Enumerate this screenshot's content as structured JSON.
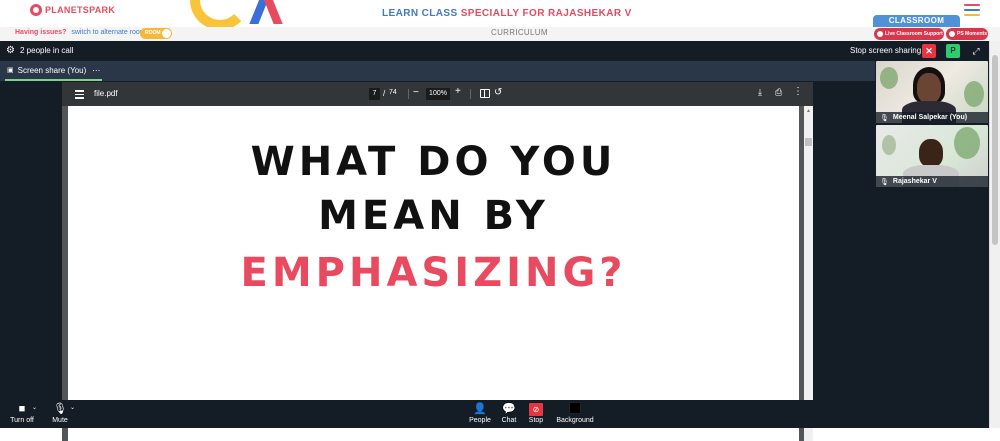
{
  "brand": {
    "logo_text": "PLANETSPARK",
    "headline_part1": "LEARN CLASS ",
    "headline_part2": "SPECIALLY FOR RAJASHEKAR V",
    "menu_colors": [
      "#e84a5f",
      "#3f79c8",
      "#f5b93a"
    ]
  },
  "issue_bar": {
    "question": "Having issues?",
    "link": "switch to alternate room",
    "toggle_label": "ROOM",
    "curriculum": "CURRICULUM",
    "classroom_tab": "CLASSROOM",
    "support_pill": "Live Classroom Support",
    "moments_pill": "PS Moments"
  },
  "call": {
    "people_count": "2 people in call",
    "stop_sharing": "Stop screen sharing",
    "close_button": "✕",
    "p_button": "P",
    "share_tab_label": "Screen share (You)"
  },
  "pdf": {
    "file_name": "file.pdf",
    "current_page": "7",
    "page_separator": "/",
    "total_pages": "74",
    "zoom": "100%",
    "slide_line1": "WHAT DO YOU",
    "slide_line2": "MEAN BY",
    "slide_line3": "EMPHASIZING?"
  },
  "participants": [
    {
      "name": "Meenal Salpekar (You)"
    },
    {
      "name": "Rajashekar V"
    }
  ],
  "controls": {
    "camera": "Turn off",
    "mic": "Mute",
    "people": "People",
    "chat": "Chat",
    "stop": "Stop",
    "background": "Background"
  },
  "colors": {
    "accent_red": "#e84a5f",
    "accent_blue": "#3f79c8",
    "call_background": "#141c26",
    "share_green": "#2ecc71"
  }
}
